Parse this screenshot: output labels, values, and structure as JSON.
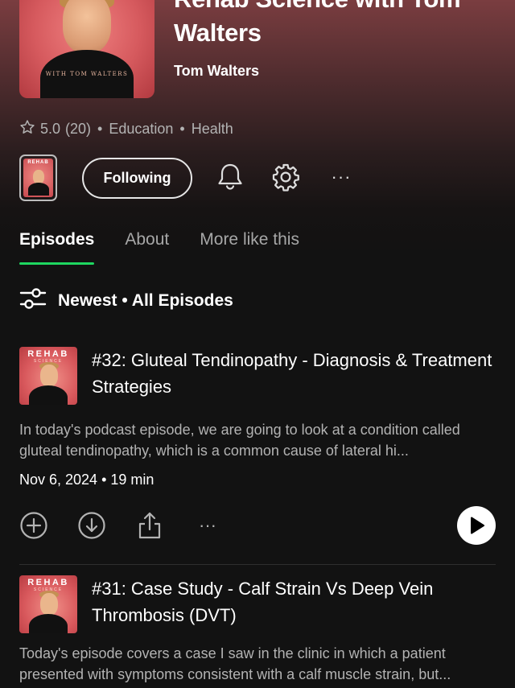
{
  "podcast": {
    "title": "Rehab Science with Tom Walters",
    "author": "Tom Walters",
    "cover_tagline": "WITH TOM WALTERS",
    "rating": "5.0",
    "rating_count": "(20)",
    "categories": [
      "Education",
      "Health"
    ],
    "mini_cover_text": "REHAB"
  },
  "actions": {
    "follow_label": "Following",
    "more_label": "···"
  },
  "tabs": [
    {
      "label": "Episodes",
      "active": true
    },
    {
      "label": "About",
      "active": false
    },
    {
      "label": "More like this",
      "active": false
    }
  ],
  "filter": {
    "label": "Newest • All Episodes"
  },
  "episodes": [
    {
      "thumb_title": "REHAB",
      "thumb_sub": "SCIENCE",
      "title": "#32: Gluteal Tendinopathy - Diagnosis & Treatment Strategies",
      "description": "In today's podcast episode, we are going to look at a condition called gluteal tendinopathy, which is a common cause of lateral hi...",
      "date": "Nov 6, 2024",
      "duration": "19 min",
      "more_label": "···"
    },
    {
      "thumb_title": "REHAB",
      "thumb_sub": "SCIENCE",
      "title": "#31: Case Study - Calf Strain Vs Deep Vein Thrombosis (DVT)",
      "description": "Today's episode covers a case I saw in the clinic in which a patient presented with symptoms consistent with a calf muscle strain, but..."
    }
  ],
  "colors": {
    "accent": "#1ed760",
    "background": "#121212",
    "secondary_text": "#b3b3b3",
    "header_gradient_top": "#7a3d40"
  }
}
